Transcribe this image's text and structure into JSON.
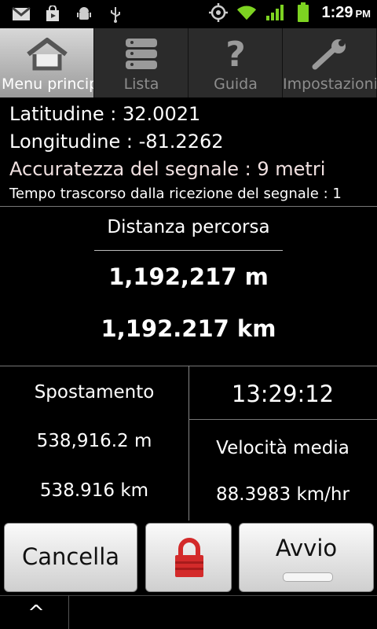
{
  "status_bar": {
    "time": "1:29",
    "ampm": "PM",
    "icons": [
      "gmail-icon",
      "play-store-icon",
      "android-debug-icon",
      "usb-icon",
      "gps-icon",
      "wifi-icon",
      "signal-icon",
      "battery-icon"
    ]
  },
  "tabs": [
    {
      "label": "Menu principale",
      "icon": "home-icon",
      "active": true
    },
    {
      "label": "Lista",
      "icon": "list-icon",
      "active": false
    },
    {
      "label": "Guida",
      "icon": "help-icon",
      "active": false
    },
    {
      "label": "Impostazioni",
      "icon": "wrench-icon",
      "active": false
    }
  ],
  "info": {
    "latitude": "Latitudine : 32.0021",
    "longitude": "Longitudine : -81.2262",
    "accuracy": "Accuratezza del segnale : 9 metri",
    "elapsed": "Tempo trascorso dalla ricezione del segnale : 1"
  },
  "distance": {
    "title": "Distanza percorsa",
    "meters": "1,192,217 m",
    "km": "1,192.217 km"
  },
  "displacement": {
    "title": "Spostamento",
    "meters": "538,916.2 m",
    "km": "538.916 km"
  },
  "clock_value": "13:29:12",
  "avg_speed": {
    "title": "Velocità media",
    "value": "88.3983 km/hr"
  },
  "buttons": {
    "cancel": "Cancella",
    "lock": "lock-icon",
    "start": "Avvio"
  },
  "bottom": {
    "caret": "^"
  },
  "colors": {
    "lock_red": "#d32a2a",
    "active_tab": "#bdbdbd",
    "wifi_green": "#7dd321"
  }
}
